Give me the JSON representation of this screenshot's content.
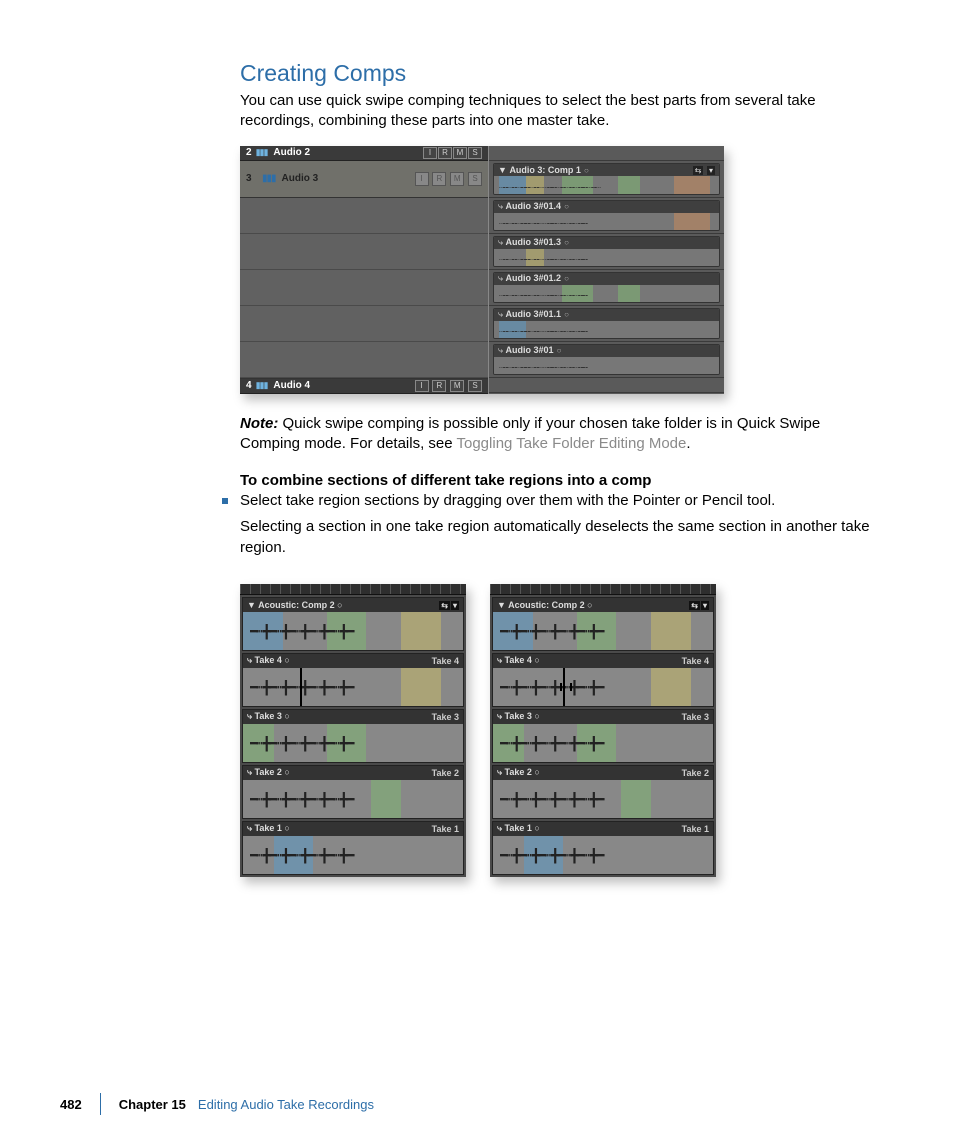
{
  "heading": "Creating Comps",
  "intro": "You can use quick swipe comping techniques to select the best parts from several take recordings, combining these parts into one master take.",
  "noteLabel": "Note:",
  "noteBody1": "Quick swipe comping is possible only if your chosen take folder is in Quick Swipe Comping mode. For details, see ",
  "noteLink": "Toggling Take Folder Editing Mode",
  "noteBody2": ".",
  "taskHeading": "To combine sections of different take regions into a comp",
  "taskStep": "Select take region sections by dragging over them with the Pointer or Pencil tool.",
  "taskResult": "Selecting a section in one take region automatically deselects the same section in another take region.",
  "fig1": {
    "topTrack": {
      "num": "2",
      "name": "Audio 2"
    },
    "mainTrack": {
      "num": "3",
      "name": "Audio 3",
      "buttons": [
        "I",
        "R",
        "M",
        "S"
      ]
    },
    "bottomTrack": {
      "num": "4",
      "name": "Audio 4",
      "buttons": [
        "I",
        "R",
        "M",
        "S"
      ]
    },
    "comp": {
      "title": "Audio 3: Comp 1",
      "ctrls": [
        "⇆",
        "▾"
      ]
    },
    "takes": [
      "Audio 3#01.4",
      "Audio 3#01.3",
      "Audio 3#01.2",
      "Audio 3#01.1",
      "Audio 3#01"
    ]
  },
  "fig2": {
    "comp": {
      "title": "Acoustic: Comp 2",
      "ctrls": [
        "⇆",
        "▾"
      ]
    },
    "takes": [
      {
        "left": "Take 4",
        "right": "Take 4"
      },
      {
        "left": "Take 3",
        "right": "Take 3"
      },
      {
        "left": "Take 2",
        "right": "Take 2"
      },
      {
        "left": "Take 1",
        "right": "Take 1"
      }
    ]
  },
  "footer": {
    "page": "482",
    "chapter": "Chapter 15",
    "title": "Editing Audio Take Recordings"
  }
}
